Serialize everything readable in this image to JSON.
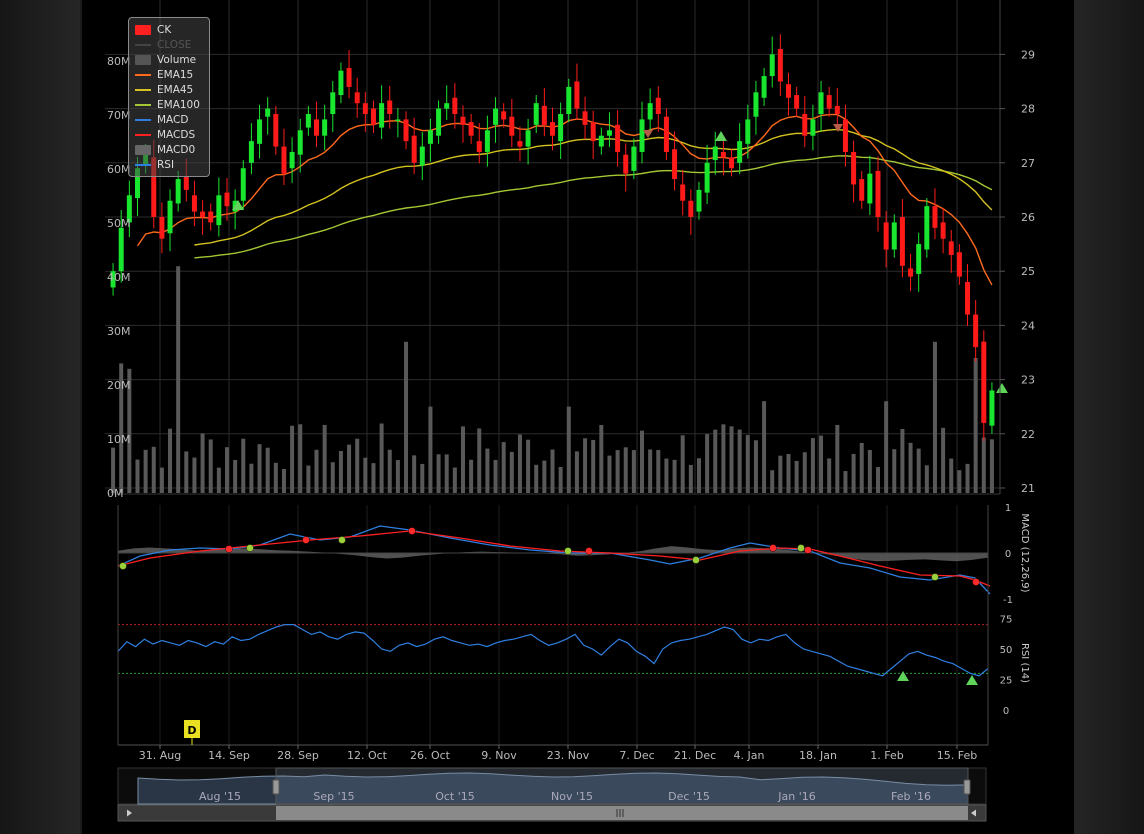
{
  "colors": {
    "up": "#19e62f",
    "down": "#ff1a1a",
    "ema15": "#ff6a1c",
    "ema45": "#d4c220",
    "ema100": "#a5c733",
    "macd": "#2f7fe0",
    "macds": "#ff2020",
    "volume": "#595959",
    "rsi": "#2f7fe0",
    "grid": "#2c2c2c",
    "marker_up": "#5fd35a",
    "marker_dot_red": "#ff2a2a",
    "marker_dot_green": "#9bcf3c",
    "flag": "#e8e021"
  },
  "legend": [
    {
      "label": "CK",
      "icon": "candle-swatch",
      "color": "#ff2020"
    },
    {
      "label": "CLOSE",
      "icon": "line-swatch",
      "color": "#444444"
    },
    {
      "label": "Volume",
      "icon": "bar-swatch",
      "color": "#555555"
    },
    {
      "label": "EMA15",
      "icon": "line-swatch",
      "color": "#ff6a1c"
    },
    {
      "label": "EMA45",
      "icon": "line-swatch",
      "color": "#d4c220"
    },
    {
      "label": "EMA100",
      "icon": "line-swatch",
      "color": "#a5c733"
    },
    {
      "label": "MACD",
      "icon": "line-swatch",
      "color": "#2f7fe0"
    },
    {
      "label": "MACDS",
      "icon": "line-swatch",
      "color": "#ff2020"
    },
    {
      "label": "MACD0",
      "icon": "bar-swatch",
      "color": "#666666"
    },
    {
      "label": "RSI",
      "icon": "line-swatch",
      "color": "#2f7fe0"
    }
  ],
  "flag_label": "D",
  "chart_data": {
    "type": "candlestick",
    "price_axis": {
      "ticks": [
        "29",
        "28",
        "27",
        "26",
        "25",
        "24",
        "23",
        "22",
        "21"
      ],
      "range": [
        21,
        29.5
      ]
    },
    "volume_axis": {
      "ticks": [
        "80M",
        "70M",
        "60M",
        "50M",
        "40M",
        "30M",
        "20M",
        "10M",
        "0M"
      ],
      "range": [
        0,
        82
      ]
    },
    "x_ticks": [
      "31. Aug",
      "14. Sep",
      "28. Sep",
      "12. Oct",
      "26. Oct",
      "9. Nov",
      "23. Nov",
      "7. Dec",
      "21. Dec",
      "4. Jan",
      "18. Jan",
      "1. Feb",
      "15. Feb"
    ],
    "close": [
      25.0,
      25.8,
      26.4,
      26.9,
      27.2,
      26.0,
      25.6,
      26.3,
      26.7,
      26.5,
      26.1,
      26.0,
      25.9,
      26.4,
      26.2,
      26.3,
      26.9,
      27.4,
      27.8,
      28.0,
      27.3,
      26.8,
      27.2,
      27.6,
      27.9,
      27.5,
      27.8,
      28.3,
      28.7,
      28.4,
      28.1,
      27.9,
      27.7,
      28.1,
      27.9,
      27.8,
      27.4,
      27.0,
      27.3,
      27.6,
      28.0,
      28.1,
      27.9,
      27.7,
      27.5,
      27.2,
      27.6,
      28.0,
      27.8,
      27.5,
      27.3,
      27.6,
      28.1,
      27.7,
      27.5,
      27.9,
      28.4,
      28.0,
      27.7,
      27.4,
      27.5,
      27.6,
      27.2,
      26.8,
      27.3,
      27.8,
      28.1,
      27.9,
      27.2,
      26.7,
      26.3,
      26.0,
      26.5,
      27.0,
      27.3,
      27.1,
      26.9,
      27.4,
      27.8,
      28.3,
      28.6,
      29.0,
      28.5,
      28.2,
      28.0,
      27.5,
      27.8,
      28.3,
      28.0,
      27.9,
      27.2,
      26.6,
      26.3,
      26.8,
      26.0,
      25.4,
      25.9,
      25.1,
      24.9,
      25.5,
      26.2,
      25.8,
      25.6,
      25.3,
      24.9,
      24.2,
      23.6,
      22.2,
      22.8
    ]
  },
  "indicators": {
    "macd_axis": {
      "ticks": [
        "1",
        "0",
        "-1"
      ],
      "range": [
        -1.05,
        1.05
      ]
    },
    "macd_label": "MACD (12,26,9)",
    "rsi_axis": {
      "ticks": [
        "75",
        "50",
        "25",
        "0"
      ],
      "range": [
        0,
        75
      ]
    },
    "rsi_label": "RSI (14)"
  },
  "navigator": {
    "months": [
      "Aug '15",
      "Sep '15",
      "Oct '15",
      "Nov '15",
      "Dec '15",
      "Jan '16",
      "Feb '16"
    ],
    "scroll_left_icon": "arrow-left-icon",
    "scroll_right_icon": "arrow-right-icon",
    "grip_icon": "grip-icon"
  }
}
